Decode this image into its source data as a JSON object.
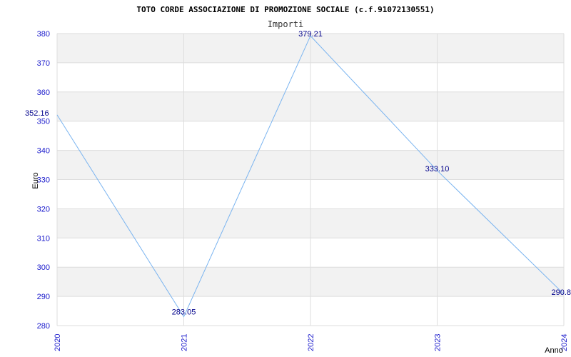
{
  "chart_data": {
    "type": "line",
    "title": "TOTO CORDE ASSOCIAZIONE DI PROMOZIONE SOCIALE (c.f.91072130551)",
    "subtitle": "Importi",
    "xlabel": "Anno",
    "ylabel": "Euro",
    "categories": [
      "2020",
      "2021",
      "2022",
      "2023",
      "2024"
    ],
    "series": [
      {
        "values": [
          352.16,
          283.05,
          379.21,
          333.1,
          290.8
        ],
        "labels": [
          "352.16",
          "283.05",
          "379.21",
          "333.10",
          "290.8"
        ],
        "color": "#7ab4f0"
      }
    ],
    "ylim": [
      280,
      380
    ],
    "yticks": [
      "280",
      "290",
      "300",
      "310",
      "320",
      "330",
      "340",
      "350",
      "360",
      "370",
      "380"
    ],
    "grid": true,
    "band_color": "#f2f2f2",
    "grid_color": "#dddddd",
    "tick_color": "#1a1acc",
    "label_color": "#00008b"
  }
}
